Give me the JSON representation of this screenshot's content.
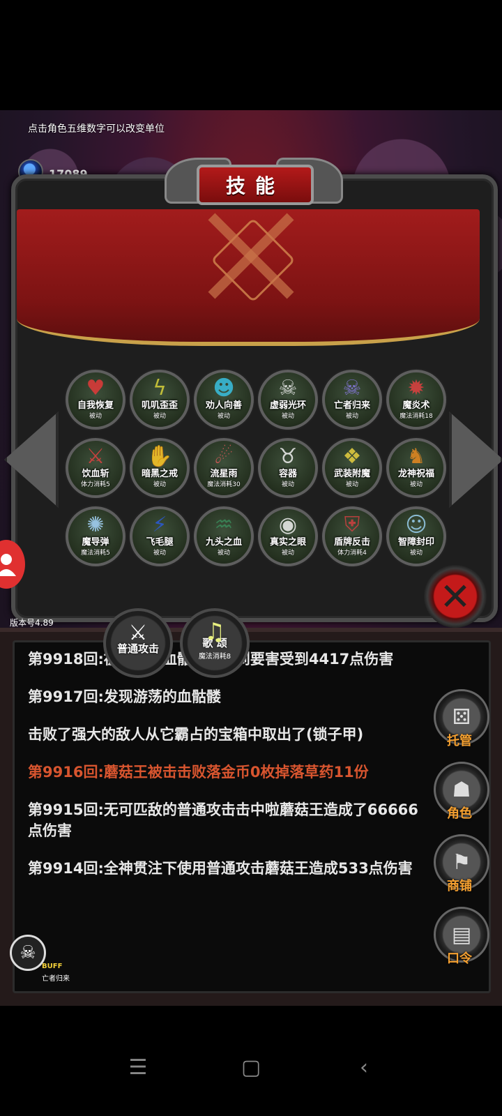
{
  "hint": "点击角色五维数字可以改变单位",
  "gems": {
    "count": "17089",
    "label": "宝石"
  },
  "panel": {
    "title": "技能"
  },
  "skills": [
    {
      "name": "自我恢复",
      "tag": "被动",
      "icon": "heart-icon",
      "color": "#e23a3a",
      "glyph": "♥"
    },
    {
      "name": "叽叽歪歪",
      "tag": "被动",
      "icon": "lightning-icon",
      "color": "#d9d23a",
      "glyph": "ϟ"
    },
    {
      "name": "劝人向善",
      "tag": "被动",
      "icon": "person-icon",
      "color": "#39c0e0",
      "glyph": "☻"
    },
    {
      "name": "虚弱光环",
      "tag": "被动",
      "icon": "ghost-icon",
      "color": "#f0f0f0",
      "glyph": "☠"
    },
    {
      "name": "亡者归来",
      "tag": "被动",
      "icon": "demon-skull-icon",
      "color": "#8a7ae6",
      "glyph": "☠"
    },
    {
      "name": "魔炎术",
      "tag": "魔法消耗18",
      "icon": "fire-bird-icon",
      "color": "#e04040",
      "glyph": "✹"
    },
    {
      "name": "饮血斩",
      "tag": "体力消耗5",
      "icon": "sword-icon",
      "color": "#e04040",
      "glyph": "⚔"
    },
    {
      "name": "暗黑之戒",
      "tag": "被动",
      "icon": "hand-icon",
      "color": "#f0f0f0",
      "glyph": "✋"
    },
    {
      "name": "流星雨",
      "tag": "魔法消耗30",
      "icon": "meteor-icon",
      "color": "#e05a5a",
      "glyph": "☄"
    },
    {
      "name": "容器",
      "tag": "被动",
      "icon": "horned-skull-icon",
      "color": "#f0f0f0",
      "glyph": "♉"
    },
    {
      "name": "武装附魔",
      "tag": "被动",
      "icon": "wings-icon",
      "color": "#e8d040",
      "glyph": "❖"
    },
    {
      "name": "龙神祝福",
      "tag": "被动",
      "icon": "dragon-icon",
      "color": "#e88a20",
      "glyph": "♞"
    },
    {
      "name": "魔导弹",
      "tag": "魔法消耗5",
      "icon": "burst-icon",
      "color": "#a8d8ff",
      "glyph": "✺"
    },
    {
      "name": "飞毛腿",
      "tag": "被动",
      "icon": "runner-icon",
      "color": "#2a5ad8",
      "glyph": "⚡"
    },
    {
      "name": "九头之血",
      "tag": "被动",
      "icon": "hydra-icon",
      "color": "#3a8a5a",
      "glyph": "♒"
    },
    {
      "name": "真实之眼",
      "tag": "被动",
      "icon": "eye-icon",
      "color": "#f0f0f0",
      "glyph": "◉"
    },
    {
      "name": "盾牌反击",
      "tag": "体力消耗4",
      "icon": "shield-icon",
      "color": "#d04040",
      "glyph": "⛨"
    },
    {
      "name": "智障封印",
      "tag": "被动",
      "icon": "seal-icon",
      "color": "#9ad0f0",
      "glyph": "☺"
    }
  ],
  "quick_skills": [
    {
      "name": "普通攻击",
      "cost": ""
    },
    {
      "name": "歌 颂",
      "cost": "魔法消耗8"
    }
  ],
  "version": "版本号4.89",
  "log": [
    {
      "text": "第9918回:被暴怒的血骷髅攻击到要害受到4417点伤害",
      "style": "normal"
    },
    {
      "text": "第9917回:发现游荡的血骷髅",
      "style": "normal"
    },
    {
      "text": "击败了强大的敌人从它霸占的宝箱中取出了(锁子甲)",
      "style": "normal"
    },
    {
      "text": "第9916回:蘑菇王被击击败落金币0枚掉落草药11份",
      "style": "red"
    },
    {
      "text": "第9915回:无可匹敌的普通攻击击中啦蘑菇王造成了66666点伤害",
      "style": "normal"
    },
    {
      "text": "第9914回:全神贯注下使用普通攻击蘑菇王造成533点伤害",
      "style": "normal"
    }
  ],
  "menu": {
    "auto": "托管",
    "character": "角色",
    "shop": "商铺",
    "code": "口令"
  },
  "buff": {
    "label": "BUFF",
    "name": "亡者归来"
  },
  "colors": {
    "accent_red": "#b31a1a",
    "log_red": "#d8552f",
    "menu_orange": "#f5a030"
  }
}
